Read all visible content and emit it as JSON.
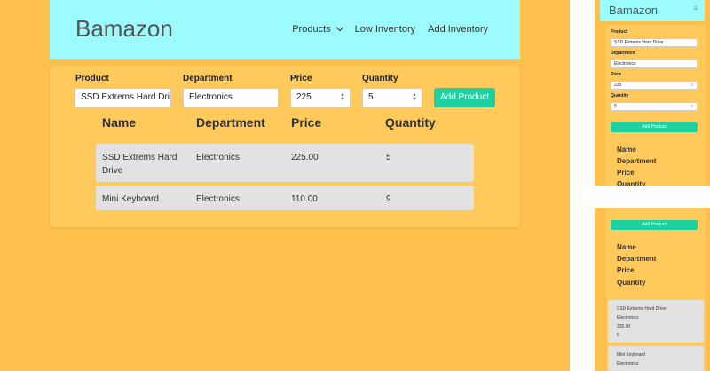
{
  "app": {
    "brand": "Bamazon",
    "nav": {
      "products": "Products",
      "low_inventory": "Low Inventory",
      "add_inventory": "Add Inventory"
    }
  },
  "form": {
    "product_label": "Product",
    "department_label": "Department",
    "price_label": "Price",
    "quantity_label": "Quantity",
    "product_value": "SSD Extrems Hard Drive",
    "department_value": "Electronics",
    "price_value": "225",
    "quantity_value": "5",
    "submit_label": "Add Product"
  },
  "table": {
    "headers": [
      "Name",
      "Department",
      "Price",
      "Quantity"
    ],
    "rows": [
      {
        "name": "SSD Extrems Hard Drive",
        "department": "Electronics",
        "price": "225.00",
        "quantity": "5"
      },
      {
        "name": "Mini Keyboard",
        "department": "Electronics",
        "price": "110.00",
        "quantity": "9"
      }
    ]
  },
  "mobile": {
    "menu_glyph": "≡"
  },
  "colors": {
    "page_bg": "#ffc04d",
    "panel_bg": "#ffc95c",
    "navbar_bg": "#9bfbfd",
    "accent": "#1dd1a1",
    "row_bg": "#e2e2e2"
  }
}
